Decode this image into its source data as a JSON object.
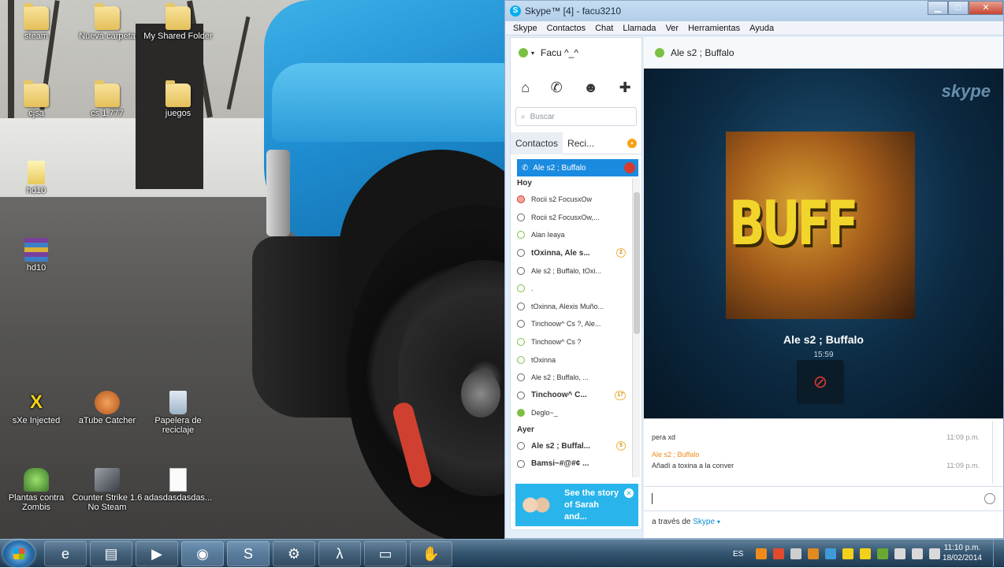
{
  "desktop": {
    "icons": [
      {
        "label": "steam",
        "kind": "folder"
      },
      {
        "label": "Nueva carpeta",
        "kind": "folder"
      },
      {
        "label": "My Shared Folder",
        "kind": "folder"
      },
      {
        "label": "cjsa",
        "kind": "folder"
      },
      {
        "label": "cs 1.777",
        "kind": "folder"
      },
      {
        "label": "juegos",
        "kind": "folder"
      },
      {
        "label": "hd10",
        "kind": "file"
      },
      {
        "label": "hd10",
        "kind": "archive"
      },
      {
        "label": "sXe Injected",
        "kind": "app"
      },
      {
        "label": "aTube Catcher",
        "kind": "app"
      },
      {
        "label": "Papelera de reciclaje",
        "kind": "recycle-bin"
      },
      {
        "label": "Plantas contra Zombis",
        "kind": "app"
      },
      {
        "label": "Counter Strike 1.6 No Steam",
        "kind": "app"
      },
      {
        "label": "adasdasdasdas...",
        "kind": "file"
      }
    ]
  },
  "skype": {
    "title": "Skype™ [4] - facu3210",
    "menu": [
      "Skype",
      "Contactos",
      "Chat",
      "Llamada",
      "Ver",
      "Herramientas",
      "Ayuda"
    ],
    "profile_name": "Facu ^_^",
    "search_placeholder": "Buscar",
    "tabs": [
      "Contactos",
      "Reci..."
    ],
    "active_call": "Ale s2 ; Buffalo",
    "groups": {
      "today": "Hoy",
      "yesterday": "Ayer"
    },
    "recents_today": [
      {
        "name": "Rocii s2 FocusxOw",
        "icon": "red"
      },
      {
        "name": "Rocii s2 FocusxOw,...",
        "icon": "gray"
      },
      {
        "name": "Alan Ieaya",
        "icon": "outline"
      },
      {
        "name": "tOxinna, Ale s...",
        "icon": "gray",
        "bold": true,
        "badge": "2"
      },
      {
        "name": "Ale s2 ; Buffalo, tOxi...",
        "icon": "gray"
      },
      {
        "name": ".",
        "icon": "outline"
      },
      {
        "name": "tOxinna, Alexis Muño...",
        "icon": "gray"
      },
      {
        "name": "Tinchoow^ Cs ?, Ale...",
        "icon": "gray"
      },
      {
        "name": "Tinchoow^ Cs ?",
        "icon": "outline"
      },
      {
        "name": "tOxinna",
        "icon": "outline"
      },
      {
        "name": "Ale s2 ; Buffalo, ...",
        "icon": "gray"
      },
      {
        "name": "Tinchoow^ C...",
        "icon": "gray",
        "bold": true,
        "badge": "17"
      },
      {
        "name": "Deglo~_",
        "icon": "green"
      }
    ],
    "recents_yesterday": [
      {
        "name": "Ale s2 ; Buffal...",
        "icon": "gray",
        "bold": true,
        "badge": "5"
      },
      {
        "name": "Bamsi~#@#¢ ...",
        "icon": "gray",
        "bold": true
      }
    ],
    "promo": "See the story of Sarah and...",
    "conversation_title": "Ale s2 ; Buffalo",
    "watermark": "skype",
    "avatar_text": "BUFF",
    "caller_name": "Ale s2 ; Buffalo",
    "call_duration": "15:59",
    "messages": [
      {
        "sender": "",
        "text": "pera xd",
        "time": "11:09 p.m."
      },
      {
        "sender": "Ale s2 ; Buffalo",
        "text": "Añadí a toxina a la conver",
        "time": "11:09 p.m."
      }
    ],
    "via_prefix": "a través de",
    "via_service": "Skype"
  },
  "taskbar": {
    "apps": [
      "internet-explorer-icon",
      "explorer-folder-icon",
      "media-player-icon",
      "chrome-icon",
      "skype-icon",
      "steam-icon",
      "half-life-icon",
      "window-icon",
      "atube-catcher-icon"
    ],
    "language": "ES",
    "time": "11:10 p.m.",
    "date": "18/02/2014"
  },
  "colors": {
    "skype_blue": "#00aff0",
    "call_red": "#d63b2f",
    "promo": "#29b5ec"
  }
}
